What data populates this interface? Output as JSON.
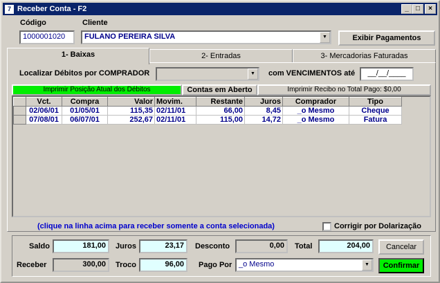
{
  "window": {
    "title": "Receber Conta - F2",
    "app_icon": "7"
  },
  "header": {
    "codigo_label": "Código",
    "codigo_value": "1000001020",
    "cliente_label": "Cliente",
    "cliente_value": "FULANO PEREIRA SILVA",
    "exibir_label": "Exibir Pagamentos"
  },
  "tabs": [
    {
      "label": "1- Baixas",
      "active": true
    },
    {
      "label": "2- Entradas",
      "active": false
    },
    {
      "label": "3- Mercadorias Faturadas",
      "active": false
    }
  ],
  "filter": {
    "localizar_label": "Localizar Débitos por COMPRADOR",
    "comprador_value": "",
    "vencimentos_label": "com VENCIMENTOS até",
    "vencimentos_value": "__/__/____"
  },
  "actions": {
    "imprimir_posicao": "Imprimir Posição Atual dos Débitos",
    "contas_aberto": "Contas em Aberto",
    "imprimir_recibo": "Imprimir Recibo no Total Pago: $0,00"
  },
  "table": {
    "columns": [
      "Vct.",
      "Compra",
      "Valor",
      "Movim.",
      "Restante",
      "Juros",
      "Comprador",
      "Tipo"
    ],
    "rows": [
      [
        "02/06/01",
        "01/05/01",
        "115,35",
        "02/11/01",
        "66,00",
        "8,45",
        "_o Mesmo",
        "Cheque"
      ],
      [
        "07/08/01",
        "06/07/01",
        "252,67",
        "02/11/01",
        "115,00",
        "14,72",
        "_o Mesmo",
        "Fatura"
      ]
    ]
  },
  "note": "(clique na linha acima para receber somente a conta selecionada)",
  "corrigir_label": "Corrigir por Dolarização",
  "totals": {
    "saldo_label": "Saldo",
    "saldo_value": "181,00",
    "juros_label": "Juros",
    "juros_value": "23,17",
    "desconto_label": "Desconto",
    "desconto_value": "0,00",
    "total_label": "Total",
    "total_value": "204,00",
    "receber_label": "Receber",
    "receber_value": "300,00",
    "troco_label": "Troco",
    "troco_value": "96,00",
    "pago_por_label": "Pago Por",
    "pago_por_value": "_o Mesmo",
    "cancelar_label": "Cancelar",
    "confirmar_label": "Confirmar"
  },
  "colors": {
    "title_bg": "#0a246a",
    "print_green": "#00ee00",
    "value_cyan": "#e0ffff",
    "text_blue": "#00008b"
  }
}
